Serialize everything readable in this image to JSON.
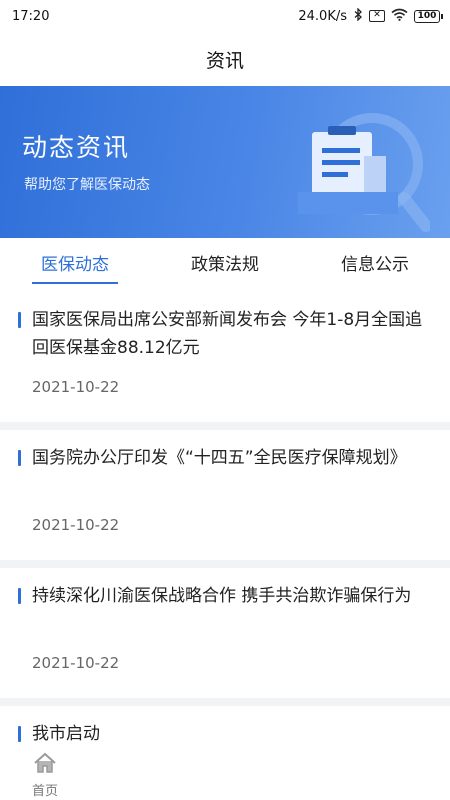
{
  "status_bar": {
    "time": "17:20",
    "net_speed": "24.0K/s",
    "battery_level": "100",
    "icons": [
      "bluetooth-icon",
      "sim-off-icon",
      "wifi-icon",
      "battery-icon"
    ]
  },
  "header": {
    "title": "资讯"
  },
  "banner": {
    "title": "动态资讯",
    "subtitle": "帮助您了解医保动态",
    "colors": {
      "start": "#2f6fd8",
      "end": "#6aa0ee"
    }
  },
  "tabs": [
    {
      "label": "医保动态",
      "active": true
    },
    {
      "label": "政策法规",
      "active": false
    },
    {
      "label": "信息公示",
      "active": false
    }
  ],
  "articles": [
    {
      "title": "国家医保局出席公安部新闻发布会 今年1-8月全国追回医保基金88.12亿元",
      "date": "2021-10-22"
    },
    {
      "title": "国务院办公厅印发《“十四五”全民医疗保障规划》",
      "date": "2021-10-22"
    },
    {
      "title": "持续深化川渝医保战略合作 携手共治欺诈骗保行为",
      "date": "2021-10-22"
    },
    {
      "title": "我市启动",
      "date": ""
    }
  ],
  "bottom_nav": {
    "home_label": "首页",
    "home_icon": "home-icon"
  },
  "accent_color": "#2f6fd8"
}
